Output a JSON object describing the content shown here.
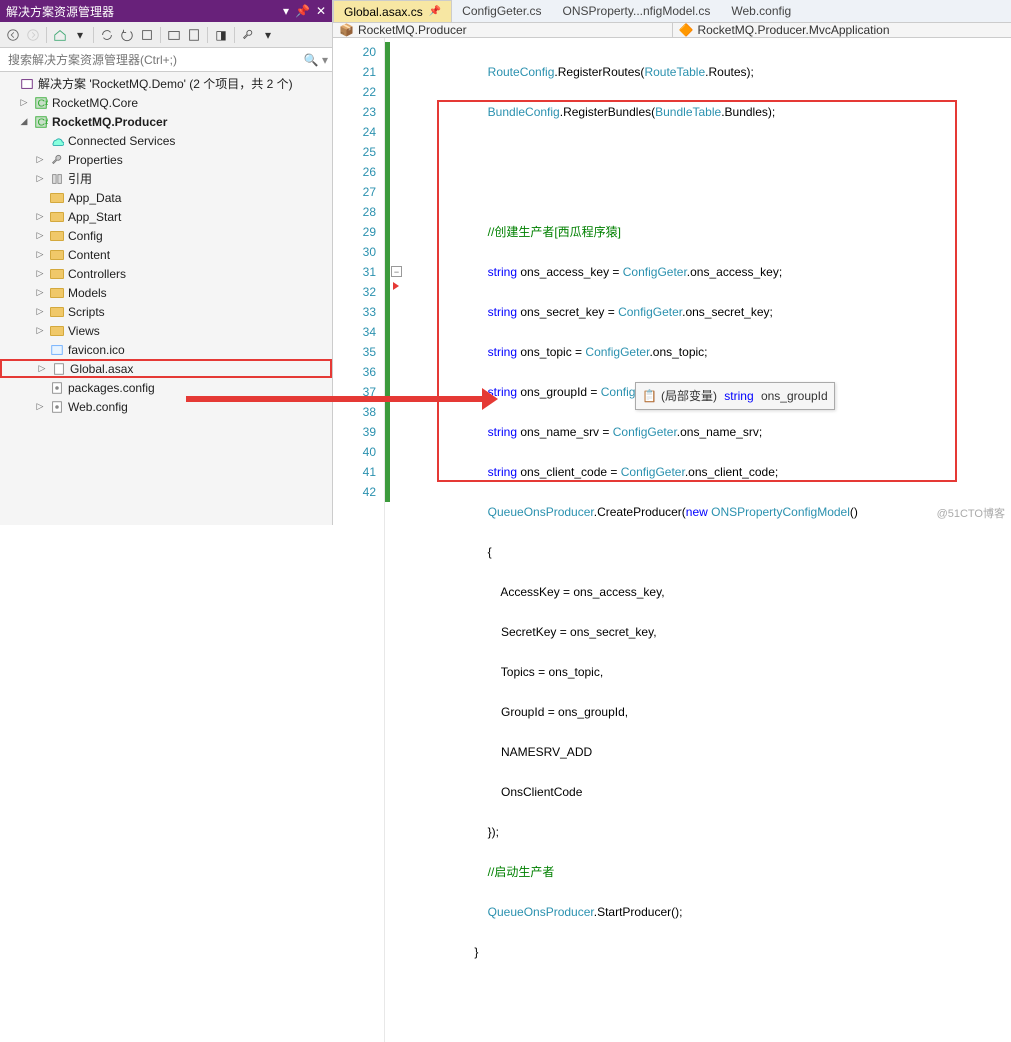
{
  "sidebar": {
    "title": "解决方案资源管理器",
    "search_placeholder": "搜索解决方案资源管理器(Ctrl+;)",
    "solution": "解决方案 'RocketMQ.Demo' (2 个项目，共 2 个)",
    "proj_core": "RocketMQ.Core",
    "proj_producer": "RocketMQ.Producer",
    "items": {
      "connected": "Connected Services",
      "properties": "Properties",
      "refs": "引用",
      "app_data": "App_Data",
      "app_start": "App_Start",
      "config": "Config",
      "content": "Content",
      "controllers": "Controllers",
      "models": "Models",
      "scripts": "Scripts",
      "views": "Views",
      "favicon": "favicon.ico",
      "global": "Global.asax",
      "packages": "packages.config",
      "webconfig": "Web.config"
    }
  },
  "tabs": {
    "t1": "Global.asax.cs",
    "t2": "ConfigGeter.cs",
    "t3": "ONSProperty...nfigModel.cs",
    "t4": "Web.config"
  },
  "nav": {
    "left": "RocketMQ.Producer",
    "right": "RocketMQ.Producer.MvcApplication"
  },
  "lines": {
    "start": 20,
    "end": 42
  },
  "code": {
    "l20a": "RouteConfig",
    "l20b": ".RegisterRoutes(",
    "l20c": "RouteTable",
    "l20d": ".Routes);",
    "l21a": "BundleConfig",
    "l21b": ".RegisterBundles(",
    "l21c": "BundleTable",
    "l21d": ".Bundles);",
    "l24": "//创建生产者[西瓜程序猿]",
    "l25a": "string",
    "l25b": " ons_access_key = ",
    "l25c": "ConfigGeter",
    "l25d": ".ons_access_key;",
    "l26a": "string",
    "l26b": " ons_secret_key = ",
    "l26c": "ConfigGeter",
    "l26d": ".ons_secret_key;",
    "l27a": "string",
    "l27b": " ons_topic = ",
    "l27c": "ConfigGeter",
    "l27d": ".ons_topic;",
    "l28a": "string",
    "l28b": " ons_groupId = ",
    "l28c": "ConfigGeter",
    "l28d": ".ons_groupId;",
    "l29a": "string",
    "l29b": " ons_name_srv = ",
    "l29c": "ConfigGeter",
    "l29d": ".ons_name_srv;",
    "l30a": "string",
    "l30b": " ons_client_code = ",
    "l30c": "ConfigGeter",
    "l30d": ".ons_client_code;",
    "l31a": "QueueOnsProducer",
    "l31b": ".CreateProducer(",
    "l31c": "new ",
    "l31d": "ONSPropertyConfigModel",
    "l31e": "()",
    "l32": "{",
    "l33": "    AccessKey = ons_access_key,",
    "l34": "    SecretKey = ons_secret_key,",
    "l35": "    Topics = ons_topic,",
    "l36": "    GroupId = ons_groupId,",
    "l37": "    NAMESRV_ADD",
    "l38": "    OnsClientCode",
    "l39": "});",
    "l40": "//启动生产者",
    "l41a": "QueueOnsProducer",
    "l41b": ".StartProducer();",
    "l42": "}"
  },
  "tooltip": {
    "icon": "📋",
    "text1": "(局部变量) ",
    "kw": "string",
    "text2": " ons_groupId"
  },
  "watermark": "@51CTO博客"
}
